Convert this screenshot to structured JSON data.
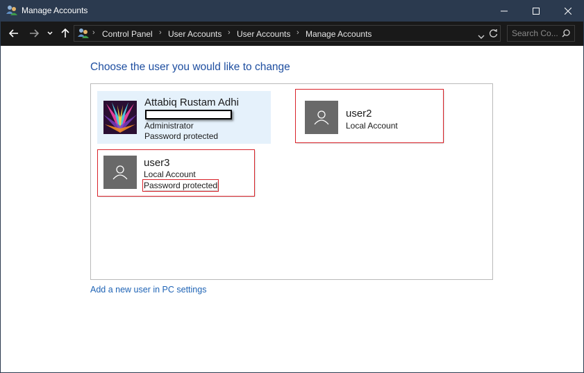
{
  "window": {
    "title": "Manage Accounts",
    "accent": "#2b3a4f"
  },
  "titlebar_buttons": [
    {
      "name": "minimize",
      "icon": "minimize-icon"
    },
    {
      "name": "maximize",
      "icon": "maximize-icon"
    },
    {
      "name": "close",
      "icon": "close-icon"
    }
  ],
  "address": {
    "breadcrumbs": [
      "Control Panel",
      "User Accounts",
      "User Accounts",
      "Manage Accounts"
    ],
    "search_placeholder": "Search Co..."
  },
  "main": {
    "heading": "Choose the user you would like to change",
    "add_user_link": "Add a new user in PC settings",
    "link_color": "#1e63b5",
    "heading_color": "#1e4ea0",
    "highlight_color": "#d9232a"
  },
  "users": [
    {
      "name": "Attabiq Rustam Adhi",
      "lines": [
        "Administrator",
        "Password protected"
      ],
      "avatar": "photo-avatar",
      "selected": true
    },
    {
      "name": "user2",
      "lines": [
        "Local Account"
      ],
      "avatar": "default-user-icon",
      "highlighted": true
    },
    {
      "name": "user3",
      "lines": [
        "Local Account",
        "Password protected"
      ],
      "avatar": "default-user-icon",
      "highlighted": true
    }
  ]
}
